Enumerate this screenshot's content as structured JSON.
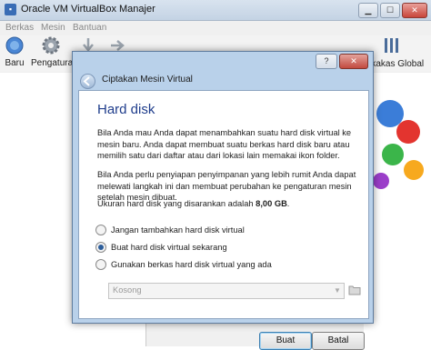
{
  "main_window": {
    "title": "Oracle VM VirtualBox Manajer",
    "menu": [
      "Berkas",
      "Mesin",
      "Bantuan"
    ],
    "toolbar": {
      "new_label": "Baru",
      "settings_label": "Pengaturan",
      "global_tools_label": "rkakas Global"
    }
  },
  "dialog": {
    "title": "Ciptakan Mesin Virtual",
    "help_button": "?",
    "section_title": "Hard disk",
    "paragraph1": "Bila Anda mau Anda dapat menambahkan suatu hard disk virtual ke mesin baru. Anda dapat membuat suatu berkas hard disk baru atau memilih satu dari daftar atau dari lokasi lain memakai ikon folder.",
    "paragraph2": "Bila Anda perlu penyiapan penyimpanan yang lebih rumit Anda dapat melewati langkah ini dan membuat perubahan ke pengaturan mesin setelah mesin dibuat.",
    "recommended_prefix": "Ukuran hard disk yang disarankan adalah ",
    "recommended_size": "8,00 GB",
    "recommended_suffix": ".",
    "options": [
      {
        "label": "Jangan tambahkan hard disk virtual",
        "selected": false
      },
      {
        "label": "Buat hard disk virtual sekarang",
        "selected": true
      },
      {
        "label": "Gunakan berkas hard disk virtual yang ada",
        "selected": false
      }
    ],
    "existing_disk_combo": "Kosong",
    "create_button": "Buat",
    "cancel_button": "Batal"
  }
}
